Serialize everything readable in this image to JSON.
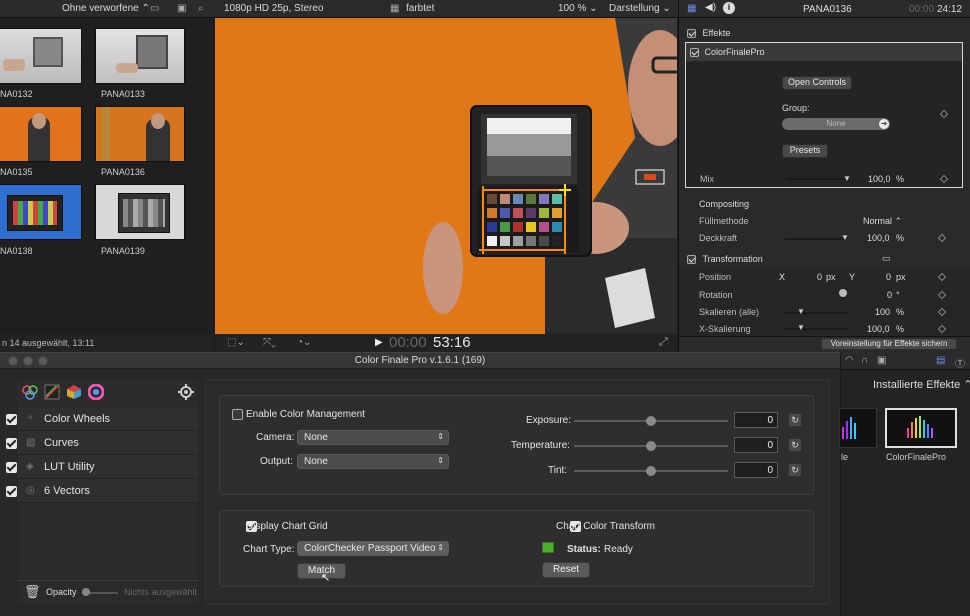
{
  "toolbar": {
    "filter_label": "Ohne verworfene",
    "format_label": "1080p HD 25p, Stereo",
    "project_name": "farbtet",
    "zoom_label": "100 %",
    "view_label": "Darstellung",
    "clip_title": "PANA0136",
    "timecode_dim": "00:00",
    "timecode": "24:12"
  },
  "browser": {
    "clips": [
      {
        "name": "NA0132"
      },
      {
        "name": "PANA0133"
      },
      {
        "name": "NA0135"
      },
      {
        "name": "PANA0136"
      },
      {
        "name": "NA0138"
      },
      {
        "name": "PANA0139"
      }
    ],
    "status": "n 14 ausgewählt, 13:11"
  },
  "viewer": {
    "timecode_dim": "00:00",
    "timecode": "53:16"
  },
  "inspector": {
    "effects_header": "Effekte",
    "effect_name": "ColorFinalePro",
    "open_controls": "Open Controls",
    "group_label": "Group:",
    "group_value": "None",
    "presets": "Presets",
    "mix_label": "Mix",
    "mix_value": "100,0",
    "mix_unit": "%",
    "compositing": "Compositing",
    "fill_label": "Füllmethode",
    "fill_value": "Normal",
    "opacity_label": "Deckkraft",
    "opacity_value": "100,0",
    "opacity_unit": "%",
    "transform": "Transformation",
    "position_label": "Position",
    "pos_x_label": "X",
    "pos_x_value": "0",
    "pos_x_unit": "px",
    "pos_y_label": "Y",
    "pos_y_value": "0",
    "pos_y_unit": "px",
    "rotation_label": "Rotation",
    "rotation_value": "0",
    "rotation_unit": "°",
    "scale_all_label": "Skalieren (alle)",
    "scale_all_value": "100",
    "scale_all_unit": "%",
    "scale_x_label": "X-Skalierung",
    "scale_x_value": "100,0",
    "scale_x_unit": "%",
    "save_preset": "Voreinstellung für Effekte sichern"
  },
  "plugin": {
    "title": "Color Finale Pro v.1.6.1 (169)",
    "modules": [
      {
        "label": "Color Wheels",
        "checked": true
      },
      {
        "label": "Curves",
        "checked": true
      },
      {
        "label": "LUT Utility",
        "checked": true
      },
      {
        "label": "6 Vectors",
        "checked": true
      }
    ],
    "opacity_label": "Opacity",
    "nothing_selected": "Nichts ausgewählt",
    "enable_cm": "Enable Color Management",
    "camera_label": "Camera:",
    "camera_value": "None",
    "output_label": "Output:",
    "output_value": "None",
    "exposure_label": "Exposure:",
    "exposure_value": "0",
    "temperature_label": "Temperature:",
    "temperature_value": "0",
    "tint_label": "Tint:",
    "tint_value": "0",
    "display_grid": "Display Chart Grid",
    "chart_type_label": "Chart Type:",
    "chart_type_value": "ColorChecker Passport Video",
    "match": "Match",
    "chart_transform": "Chart Color Transform",
    "status_label": "Status:",
    "status_value": "Ready",
    "reset": "Reset",
    "status_color": "#4caf2a"
  },
  "effects_browser": {
    "header": "Installierte Effekte",
    "items": [
      {
        "name": "le"
      },
      {
        "name": "ColorFinalePro"
      }
    ]
  }
}
